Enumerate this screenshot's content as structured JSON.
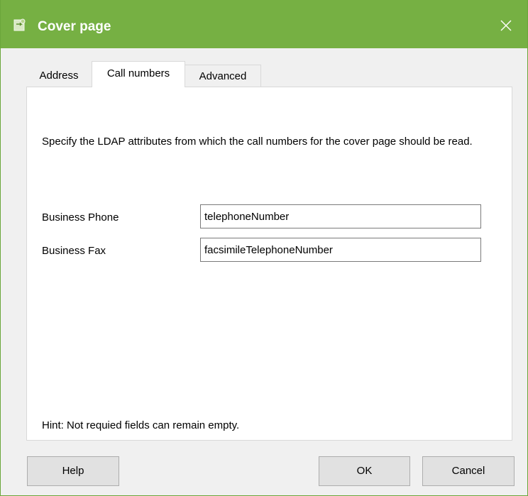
{
  "window": {
    "title": "Cover page",
    "icon": "app-icon",
    "close_icon": "close-icon"
  },
  "tabs": [
    {
      "label": "Address",
      "active": false
    },
    {
      "label": "Call numbers",
      "active": true
    },
    {
      "label": "Advanced",
      "active": false
    }
  ],
  "panel": {
    "description": "Specify the LDAP attributes from which the call numbers for the cover page should be read.",
    "fields": [
      {
        "label": "Business Phone",
        "value": "telephoneNumber"
      },
      {
        "label": "Business Fax",
        "value": "facsimileTelephoneNumber"
      }
    ],
    "hint": "Hint: Not requied fields can remain empty."
  },
  "buttons": {
    "help": "Help",
    "ok": "OK",
    "cancel": "Cancel"
  },
  "colors": {
    "titlebar": "#76b043",
    "title_text": "#ffffff",
    "dialog_background": "#f0f0f0",
    "panel_background": "#ffffff",
    "button_background": "#e1e1e1"
  }
}
